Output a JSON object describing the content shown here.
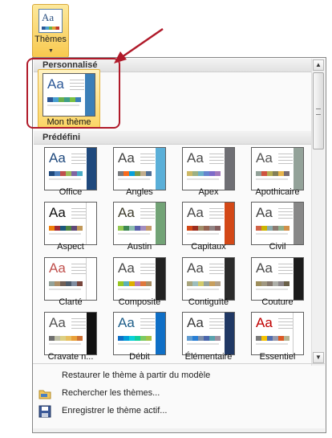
{
  "ribbon": {
    "label": "Thèmes",
    "icon": "themes-icon"
  },
  "custom_section": {
    "title": "Personnalisé",
    "themes": [
      {
        "label": "Mon thème",
        "aa_color": "#2b5797",
        "side": "#3b7fb8",
        "swatches": [
          "#2b5797",
          "#48a0d0",
          "#6ab04c",
          "#3f9e8a",
          "#7ac143",
          "#3b7fb8"
        ]
      }
    ]
  },
  "builtin_section": {
    "title": "Prédéfini",
    "themes": [
      {
        "label": "Office",
        "aa_color": "#1f497d",
        "side": "#1f497d",
        "swatches": [
          "#1f497d",
          "#4f81bd",
          "#c0504d",
          "#9bbb59",
          "#8064a2",
          "#4bacc6"
        ]
      },
      {
        "label": "Angles",
        "aa_color": "#434342",
        "side": "#5aafd8",
        "swatches": [
          "#797b7e",
          "#f96a1b",
          "#08a1d9",
          "#7c984a",
          "#c2ad8d",
          "#506e94"
        ]
      },
      {
        "label": "Apex",
        "aa_color": "#4b4b4b",
        "side": "#6f6f74",
        "swatches": [
          "#ceb966",
          "#9cb084",
          "#6bb1c9",
          "#6585cf",
          "#7e6bc9",
          "#a379bb"
        ]
      },
      {
        "label": "Apothicaire",
        "aa_color": "#555555",
        "side": "#93a299",
        "swatches": [
          "#93a299",
          "#cf543f",
          "#b5ae53",
          "#848058",
          "#e8b54d",
          "#786c71"
        ]
      },
      {
        "label": "Aspect",
        "aa_color": "#111111",
        "side": "#ffffff",
        "swatches": [
          "#f07f09",
          "#9f2936",
          "#1b587c",
          "#4e8542",
          "#604878",
          "#c19859"
        ]
      },
      {
        "label": "Austin",
        "aa_color": "#3e3d2d",
        "side": "#72a376",
        "swatches": [
          "#94c954",
          "#3e8853",
          "#8dbdaf",
          "#5a5fab",
          "#a38dc0",
          "#c49a6c"
        ]
      },
      {
        "label": "Capitaux",
        "aa_color": "#4a4a4a",
        "side": "#d34817",
        "swatches": [
          "#d34817",
          "#9b2d1f",
          "#a28e6a",
          "#956251",
          "#918485",
          "#855d5d"
        ]
      },
      {
        "label": "Civil",
        "aa_color": "#444444",
        "side": "#888888",
        "swatches": [
          "#d16349",
          "#ccb400",
          "#8cadae",
          "#8c7b70",
          "#8fb08c",
          "#d19049"
        ]
      },
      {
        "label": "Clarté",
        "aa_color": "#c0504d",
        "side": "#ffffff",
        "swatches": [
          "#93a299",
          "#ad8f67",
          "#726056",
          "#4c5a6a",
          "#808da0",
          "#79463d"
        ]
      },
      {
        "label": "Composite",
        "aa_color": "#4a4a4a",
        "side": "#222222",
        "swatches": [
          "#98c723",
          "#59b0b9",
          "#deae00",
          "#b77bb4",
          "#e0773c",
          "#a98d63"
        ]
      },
      {
        "label": "Contiguïté",
        "aa_color": "#4a4a4a",
        "side": "#2b2b2b",
        "swatches": [
          "#a9a57c",
          "#9cbebd",
          "#d2cb6c",
          "#95a39d",
          "#c89f5d",
          "#b1a089"
        ]
      },
      {
        "label": "Couture",
        "aa_color": "#4a4a4a",
        "side": "#1c1c1c",
        "swatches": [
          "#9e8e5c",
          "#a09781",
          "#85776d",
          "#aeafa9",
          "#8d878b",
          "#6b6149"
        ]
      },
      {
        "label": "Cravate n...",
        "aa_color": "#555555",
        "side": "#111111",
        "swatches": [
          "#6f6f6f",
          "#bfbfa5",
          "#dcd084",
          "#e7bf5f",
          "#e9a039",
          "#cf7133"
        ]
      },
      {
        "label": "Débit",
        "aa_color": "#1f5f8a",
        "side": "#0f6fc6",
        "swatches": [
          "#0f6fc6",
          "#009dd9",
          "#0bd0d9",
          "#10cf9b",
          "#7cca62",
          "#a5c249"
        ]
      },
      {
        "label": "Élémentaire",
        "aa_color": "#3b3b3b",
        "side": "#203864",
        "swatches": [
          "#629dd1",
          "#297fd5",
          "#7f8fa9",
          "#4a66ac",
          "#5aa2ae",
          "#9d90a0"
        ]
      },
      {
        "label": "Essentiel",
        "aa_color": "#c00000",
        "side": "#ffffff",
        "swatches": [
          "#7a7a7a",
          "#f5c201",
          "#526db0",
          "#989aac",
          "#dc5924",
          "#b4b392"
        ]
      }
    ]
  },
  "menu_items": [
    {
      "label": "Restaurer le thème à partir du modèle",
      "icon": null
    },
    {
      "label": "Rechercher les thèmes...",
      "icon": "folder-icon"
    },
    {
      "label": "Enregistrer le thème actif...",
      "icon": "save-icon"
    }
  ]
}
